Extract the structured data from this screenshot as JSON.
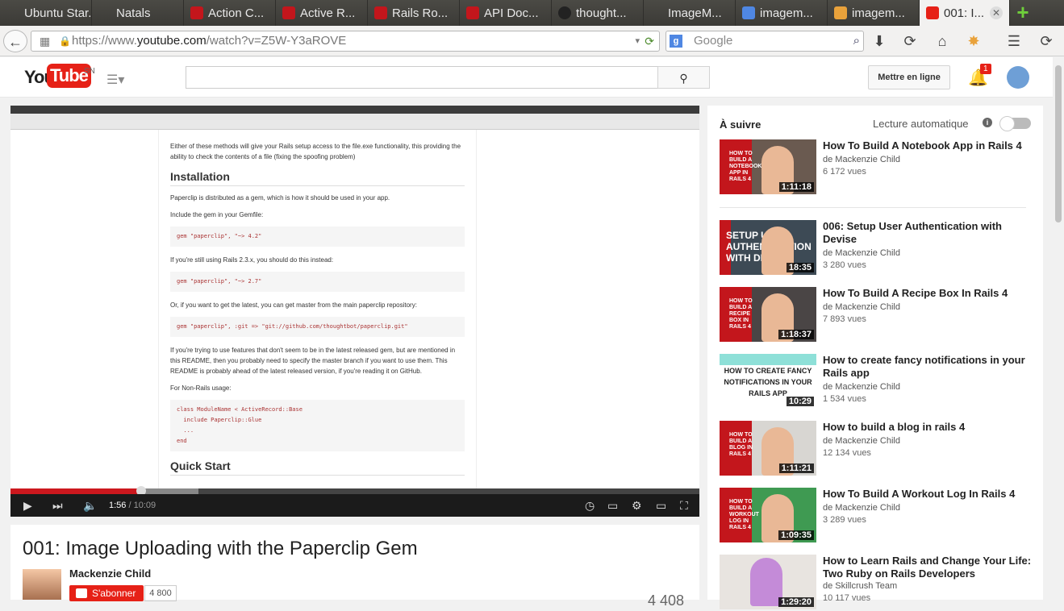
{
  "tabs": [
    {
      "label": "Ubuntu Star...",
      "color": "#4b4a45"
    },
    {
      "label": "Natals",
      "color": "#4b4a45"
    },
    {
      "label": "Action C...",
      "color": "#c3161c"
    },
    {
      "label": "Active R...",
      "color": "#c3161c"
    },
    {
      "label": "Rails Ro...",
      "color": "#c3161c"
    },
    {
      "label": "API Doc...",
      "color": "#c3161c"
    },
    {
      "label": "thought...",
      "color": "#222222"
    },
    {
      "label": "ImageM...",
      "color": "#4b4a45"
    },
    {
      "label": "imagem...",
      "color": "#4f87e3"
    },
    {
      "label": "imagem...",
      "color": "#e9a23b"
    }
  ],
  "active_tab": {
    "label": "001: I...",
    "color": "#e62117"
  },
  "url": {
    "prefix": "https://www.",
    "domain": "youtube.com",
    "path": "/watch?v=Z5W-Y3aROVE"
  },
  "search_engine": {
    "placeholder": "Google"
  },
  "header": {
    "logo_you": "You",
    "logo_tube": "Tube",
    "region": "SN",
    "upload": "Mettre en ligne",
    "notifications": "1"
  },
  "player": {
    "doc_intro": "Either of these methods will give your Rails setup access to the file.exe functionality, this providing the ability to check the contents of a file (fixing the spoofing problem)",
    "h_install": "Installation",
    "p1": "Paperclip is distributed as a gem, which is how it should be used in your app.",
    "p2": "Include the gem in your Gemfile:",
    "code1": "gem \"paperclip\", \"~> 4.2\"",
    "p3": "If you're still using Rails 2.3.x, you should do this instead:",
    "code2": "gem \"paperclip\", \"~> 2.7\"",
    "p4": "Or, if you want to get the latest, you can get master from the main paperclip repository:",
    "code3": "gem \"paperclip\", :git => \"git://github.com/thoughtbot/paperclip.git\"",
    "p5": "If you're trying to use features that don't seem to be in the latest released gem, but are mentioned in this README, then you probably need to specify the master branch if you want to use them. This README is probably ahead of the latest released version, if you're reading it on GitHub.",
    "p6": "For Non-Rails usage:",
    "code4": "class ModuleName < ActiveRecord::Base\n  include Paperclip::Glue\n  ...\nend",
    "h_quick": "Quick Start",
    "time_current": "1:56",
    "time_duration": "/ 10:09",
    "progress_fraction": 0.19
  },
  "video": {
    "title": "001: Image Uploading with the Paperclip Gem",
    "channel": "Mackenzie Child",
    "subscribe": "S'abonner",
    "subs": "4 800",
    "views": "4 408"
  },
  "sidebar": {
    "heading": "À suivre",
    "autoplay": "Lecture automatique",
    "items": [
      {
        "title": "How To Build A Notebook App in Rails 4",
        "channel": "de Mackenzie Child",
        "views": "6 172 vues",
        "duration": "1:11:18",
        "thumb": "HOW TO BUILD A NOTEBOOK APP IN RAILS 4"
      },
      {
        "title": "006: Setup User Authentication with Devise",
        "channel": "de Mackenzie Child",
        "views": "3 280 vues",
        "duration": "18:35",
        "thumb": "SETUP USER AUTHENTICATION WITH DEVISE"
      },
      {
        "title": "How To Build A Recipe Box In Rails 4",
        "channel": "de Mackenzie Child",
        "views": "7 893 vues",
        "duration": "1:18:37",
        "thumb": "HOW TO BUILD A RECIPE BOX IN RAILS 4"
      },
      {
        "title": "How to create fancy notifications in your Rails app",
        "channel": "de Mackenzie Child",
        "views": "1 534 vues",
        "duration": "10:29",
        "thumb": "HOW TO CREATE FANCY NOTIFICATIONS IN YOUR RAILS APP"
      },
      {
        "title": "How to build a blog in rails 4",
        "channel": "de Mackenzie Child",
        "views": "12 134 vues",
        "duration": "1:11:21",
        "thumb": "HOW TO BUILD A BLOG IN RAILS 4"
      },
      {
        "title": "How To Build A Workout Log In Rails 4",
        "channel": "de Mackenzie Child",
        "views": "3 289 vues",
        "duration": "1:09:35",
        "thumb": "HOW TO BUILD A WORKOUT LOG IN RAILS 4"
      },
      {
        "title": "How to Learn Rails and Change Your Life: Two Ruby on Rails Developers",
        "channel": "de Skillcrush Team",
        "views": "10 117 vues",
        "duration": "1:29:20",
        "thumb": ""
      }
    ]
  }
}
